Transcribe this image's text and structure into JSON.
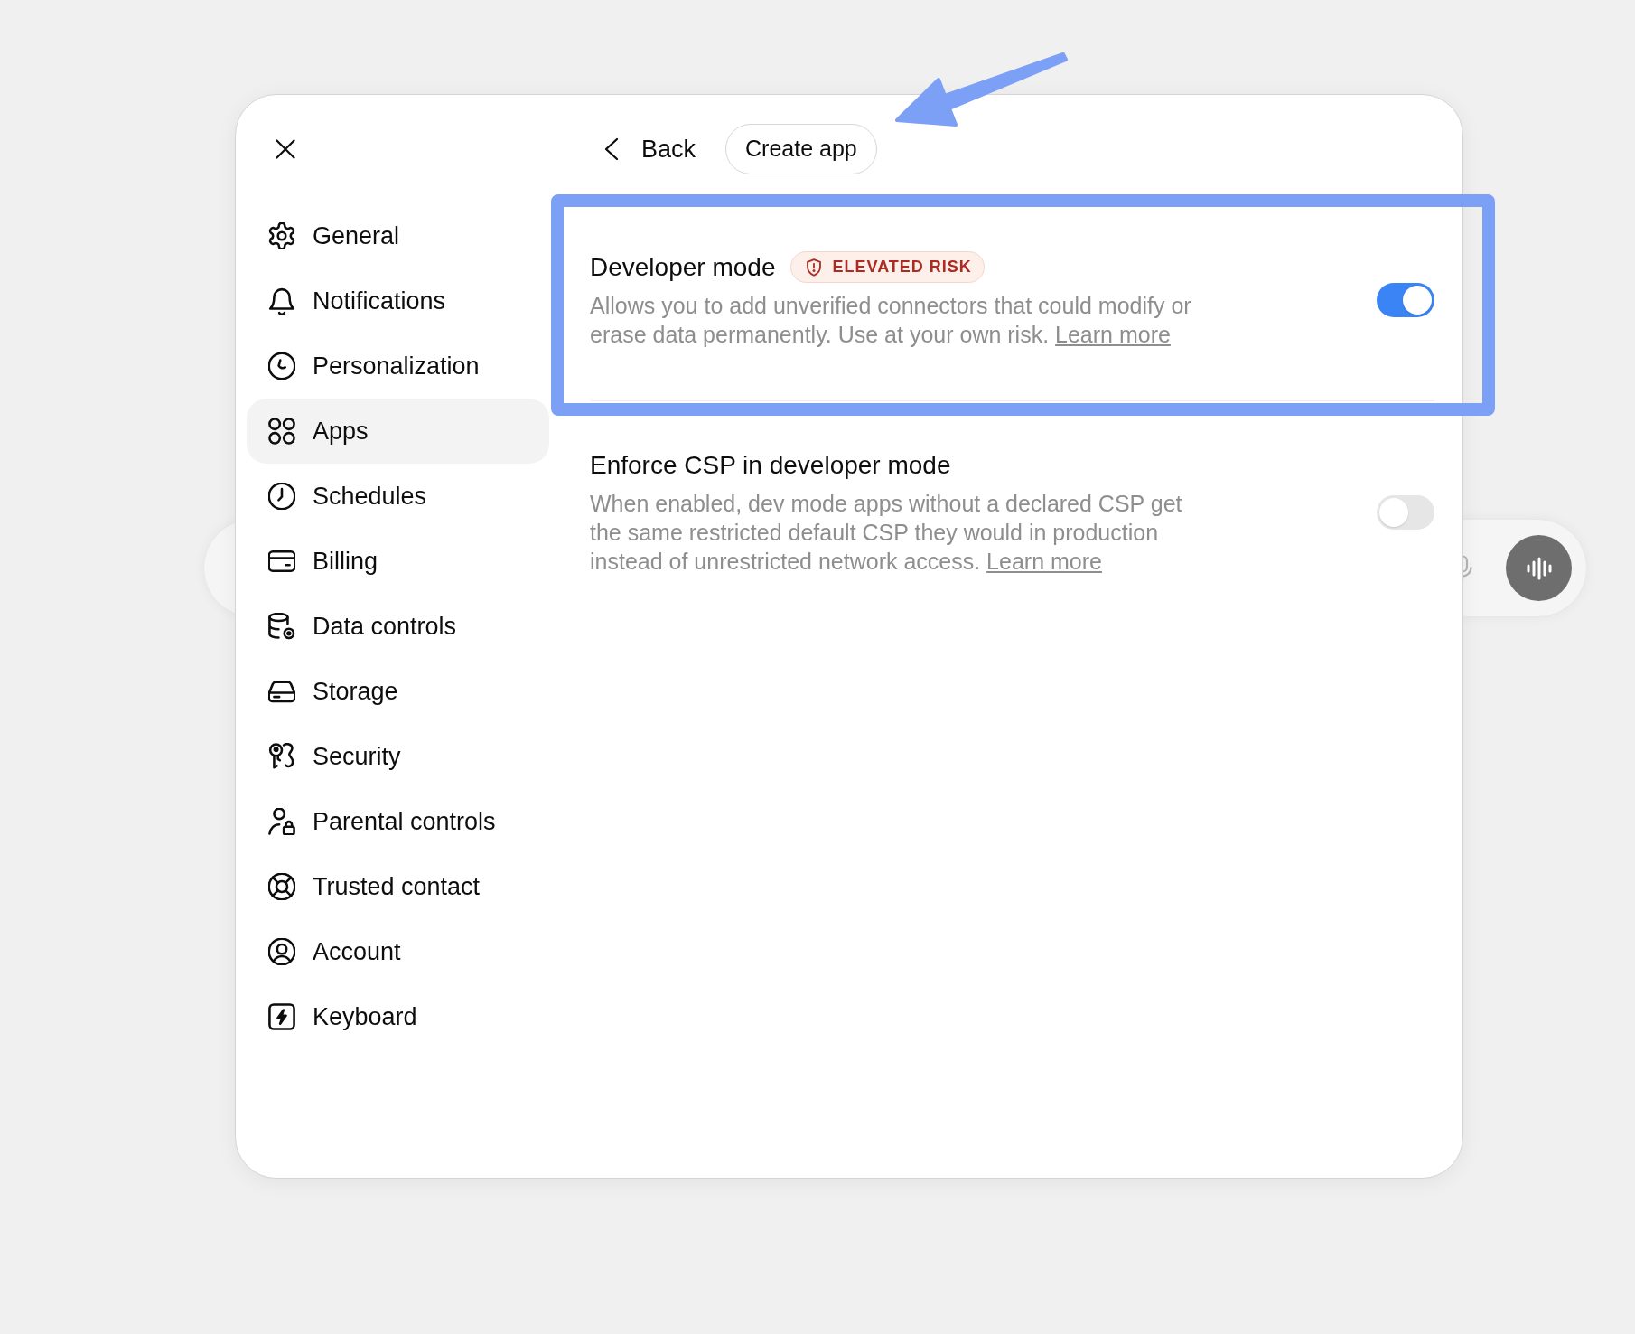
{
  "dialog": {
    "header": {
      "back_label": "Back",
      "action_label": "Create app"
    },
    "sidebar": {
      "items": [
        {
          "label": "General",
          "selected": false
        },
        {
          "label": "Notifications",
          "selected": false
        },
        {
          "label": "Personalization",
          "selected": false
        },
        {
          "label": "Apps",
          "selected": true
        },
        {
          "label": "Schedules",
          "selected": false
        },
        {
          "label": "Billing",
          "selected": false
        },
        {
          "label": "Data controls",
          "selected": false
        },
        {
          "label": "Storage",
          "selected": false
        },
        {
          "label": "Security",
          "selected": false
        },
        {
          "label": "Parental controls",
          "selected": false
        },
        {
          "label": "Trusted contact",
          "selected": false
        },
        {
          "label": "Account",
          "selected": false
        },
        {
          "label": "Keyboard",
          "selected": false
        }
      ]
    },
    "settings": [
      {
        "title": "Developer mode",
        "badge": "ELEVATED RISK",
        "description": "Allows you to add unverified connectors that could modify or erase data permanently. Use at your own risk.",
        "link": "Learn more",
        "on": true
      },
      {
        "title": "Enforce CSP in developer mode",
        "description": "When enabled, dev mode apps without a declared CSP get the same restricted default CSP they would in production instead of unrestricted network access.",
        "link": "Learn more",
        "on": false
      }
    ]
  }
}
